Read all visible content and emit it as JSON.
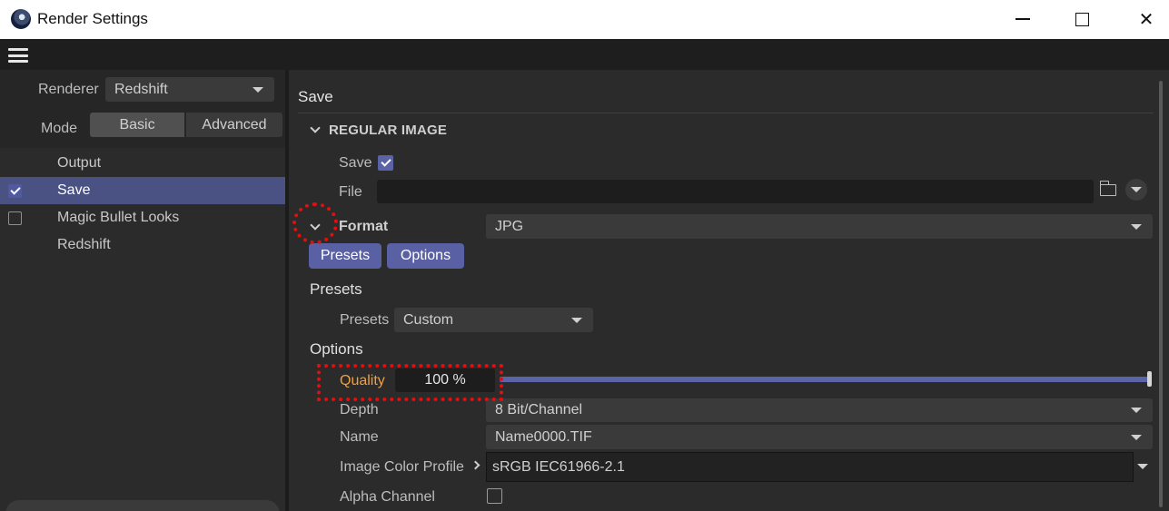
{
  "window": {
    "title": "Render Settings",
    "app_icon": "cinema4d-icon"
  },
  "menubar": {
    "icon": "hamburger-menu-icon"
  },
  "left_panel": {
    "renderer_label": "Renderer",
    "renderer_value": "Redshift",
    "mode_label": "Mode",
    "mode_options": [
      "Basic",
      "Advanced"
    ],
    "mode_selected": "Basic",
    "items": [
      {
        "label": "Output",
        "checkbox": null
      },
      {
        "label": "Save",
        "checkbox": true,
        "selected": true
      },
      {
        "label": "Magic Bullet Looks",
        "checkbox": false
      },
      {
        "label": "Redshift",
        "checkbox": null
      }
    ]
  },
  "main": {
    "title": "Save",
    "section": "REGULAR IMAGE",
    "save_label": "Save",
    "save_checked": true,
    "file_label": "File",
    "file_value": "",
    "format_label": "Format",
    "format_value": "JPG",
    "tabs": [
      "Presets",
      "Options"
    ],
    "presets_heading": "Presets",
    "presets_label": "Presets",
    "presets_value": "Custom",
    "options_heading": "Options",
    "quality_label": "Quality",
    "quality_value": "100 %",
    "quality_fraction": 1.0,
    "depth_label": "Depth",
    "depth_value": "8 Bit/Channel",
    "name_label": "Name",
    "name_value": "Name0000.TIF",
    "profile_label": "Image Color Profile",
    "profile_value": "sRGB IEC61966-2.1",
    "alpha_label": "Alpha Channel",
    "alpha_checked": false
  },
  "colors": {
    "accent": "#5960a4",
    "selected_row": "#4a5283",
    "quality_label": "#f0a040",
    "annotation": "#e01010"
  }
}
